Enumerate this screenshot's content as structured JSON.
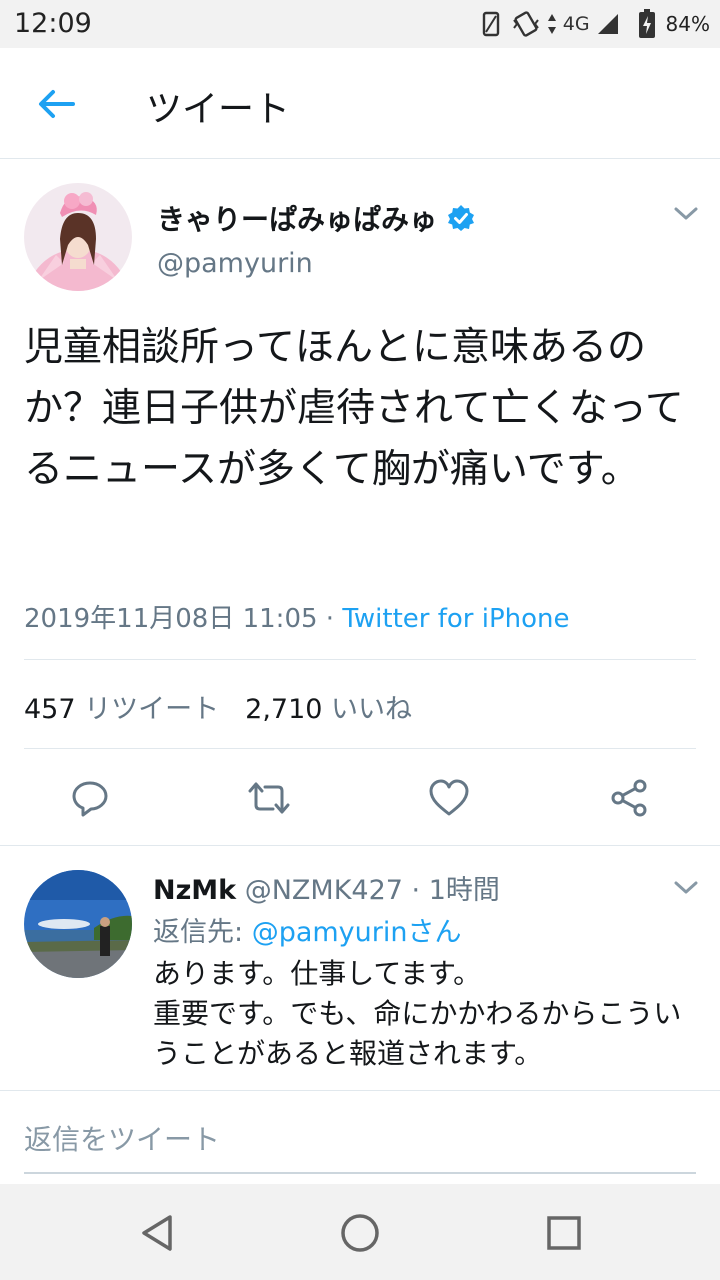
{
  "status_bar": {
    "time": "12:09",
    "network": "4G",
    "battery": "84%"
  },
  "header": {
    "title": "ツイート"
  },
  "tweet": {
    "author_name": "きゃりーぱみゅぱみゅ",
    "author_handle": "@pamyurin",
    "verified": true,
    "text": "児童相談所ってほんとに意味あるのか？連日子供が虐待されて亡くなってるニュースが多くて胸が痛いです。",
    "timestamp": "2019年11月08日 11:05",
    "separator": " · ",
    "source": "Twitter for iPhone",
    "retweet_count": "457",
    "retweet_label": "リツイート",
    "like_count": "2,710",
    "like_label": "いいね"
  },
  "reply": {
    "name": "NzMk",
    "handle": "@NZMK427",
    "time": "1時間",
    "separator": " · ",
    "reply_to_prefix": "返信先: ",
    "reply_to_mention": "@pamyurinさん",
    "text_line1": "あります。仕事してます。",
    "text_line2": "重要です。でも、命にかかわるからこういうことがあると報道されます。"
  },
  "compose": {
    "placeholder": "返信をツイート"
  },
  "colors": {
    "accent": "#1da1f2",
    "secondary_text": "#657786",
    "primary_text": "#14171a",
    "divider": "#e1e8ed"
  },
  "icons": {
    "back": "arrow-left-icon",
    "verified": "verified-badge-icon",
    "caret": "chevron-down-icon",
    "reply": "reply-bubble-icon",
    "retweet": "retweet-icon",
    "like": "heart-icon",
    "share": "share-icon",
    "nav_back": "triangle-back-icon",
    "nav_home": "circle-home-icon",
    "nav_recents": "square-recents-icon"
  }
}
